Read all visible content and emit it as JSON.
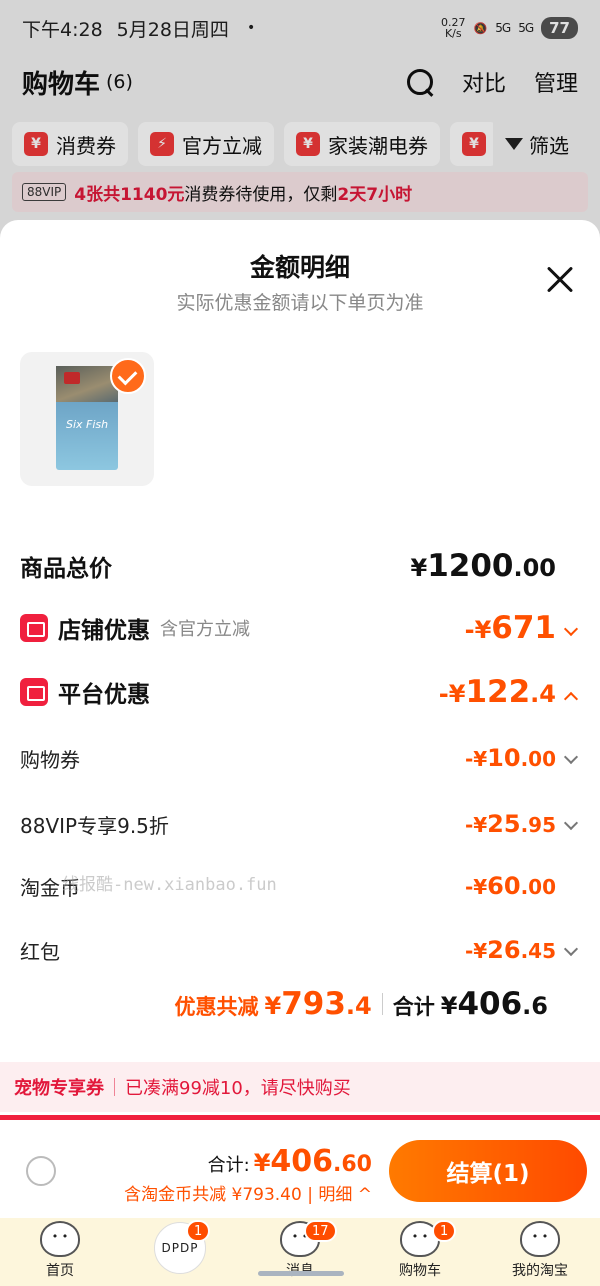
{
  "status_bar": {
    "time": "下午4:28",
    "date": "5月28日周四",
    "dot": "•",
    "net_speed": "0.27",
    "net_unit": "K/s",
    "sig1": "5G",
    "sig2": "5G",
    "battery": "77"
  },
  "cart": {
    "title": "购物车",
    "count": "(6)",
    "compare": "对比",
    "manage": "管理"
  },
  "chips": [
    {
      "icon": "¥",
      "label": "消费券"
    },
    {
      "icon": "⚡",
      "label": "官方立减"
    },
    {
      "icon": "¥",
      "label": "家装潮电券"
    }
  ],
  "chip_partial_icon": "¥",
  "filter_label": "筛选",
  "vip_bar": {
    "badge": "88VIP",
    "highlight": "4张共1140元",
    "text_mid": "消费券待使用，仅剩",
    "time_left": "2天7小时"
  },
  "sheet": {
    "title": "金额明细",
    "subtitle": "实际优惠金额请以下单页为准",
    "product_pkg_text": "Six Fish"
  },
  "rows": {
    "total": {
      "label": "商品总价",
      "yen": "¥",
      "int": "1200",
      "dec": ".00"
    },
    "store": {
      "label": "店铺优惠",
      "hint": "含官方立减",
      "prefix": "-¥",
      "int": "671",
      "dec": ""
    },
    "platform": {
      "label": "平台优惠",
      "prefix": "-¥",
      "int": "122",
      "dec": ".4"
    },
    "coupon": {
      "label": "购物券",
      "prefix": "-¥",
      "int": "10",
      "dec": ".00"
    },
    "vip": {
      "label": "88VIP专享9.5折",
      "prefix": "-¥",
      "int": "25",
      "dec": ".95"
    },
    "coin": {
      "label": "淘金币",
      "prefix": "-¥",
      "int": "60",
      "dec": ".00"
    },
    "redpack": {
      "label": "红包",
      "prefix": "-¥",
      "int": "26",
      "dec": ".45"
    }
  },
  "summary": {
    "discount_label": "优惠共减",
    "discount_yen": "¥",
    "discount_int": "793",
    "discount_dec": ".4",
    "total_label": "合计",
    "total_yen": "¥",
    "total_int": "406",
    "total_dec": ".6"
  },
  "watermark": "线报酷-new.xianbao.fun",
  "pet_bar": {
    "title": "宠物专享券",
    "text": "已凑满99减10，请尽快购买"
  },
  "checkout": {
    "total_label": "合计:",
    "yen": "¥",
    "total_int": "406",
    "total_dec": ".60",
    "sub": "含淘金币共减 ¥793.40 | 明细 ^",
    "pay_label": "结算(1)"
  },
  "tabbar": [
    {
      "label": "首页",
      "badge": ""
    },
    {
      "label": "",
      "badge": "1",
      "center": "DPDP"
    },
    {
      "label": "消息",
      "badge": "17"
    },
    {
      "label": "购物车",
      "badge": "1"
    },
    {
      "label": "我的淘宝",
      "badge": ""
    }
  ],
  "colors": {
    "accent": "#ff5000",
    "red": "#e2183b",
    "tabbar_bg": "#fdf6dc"
  }
}
